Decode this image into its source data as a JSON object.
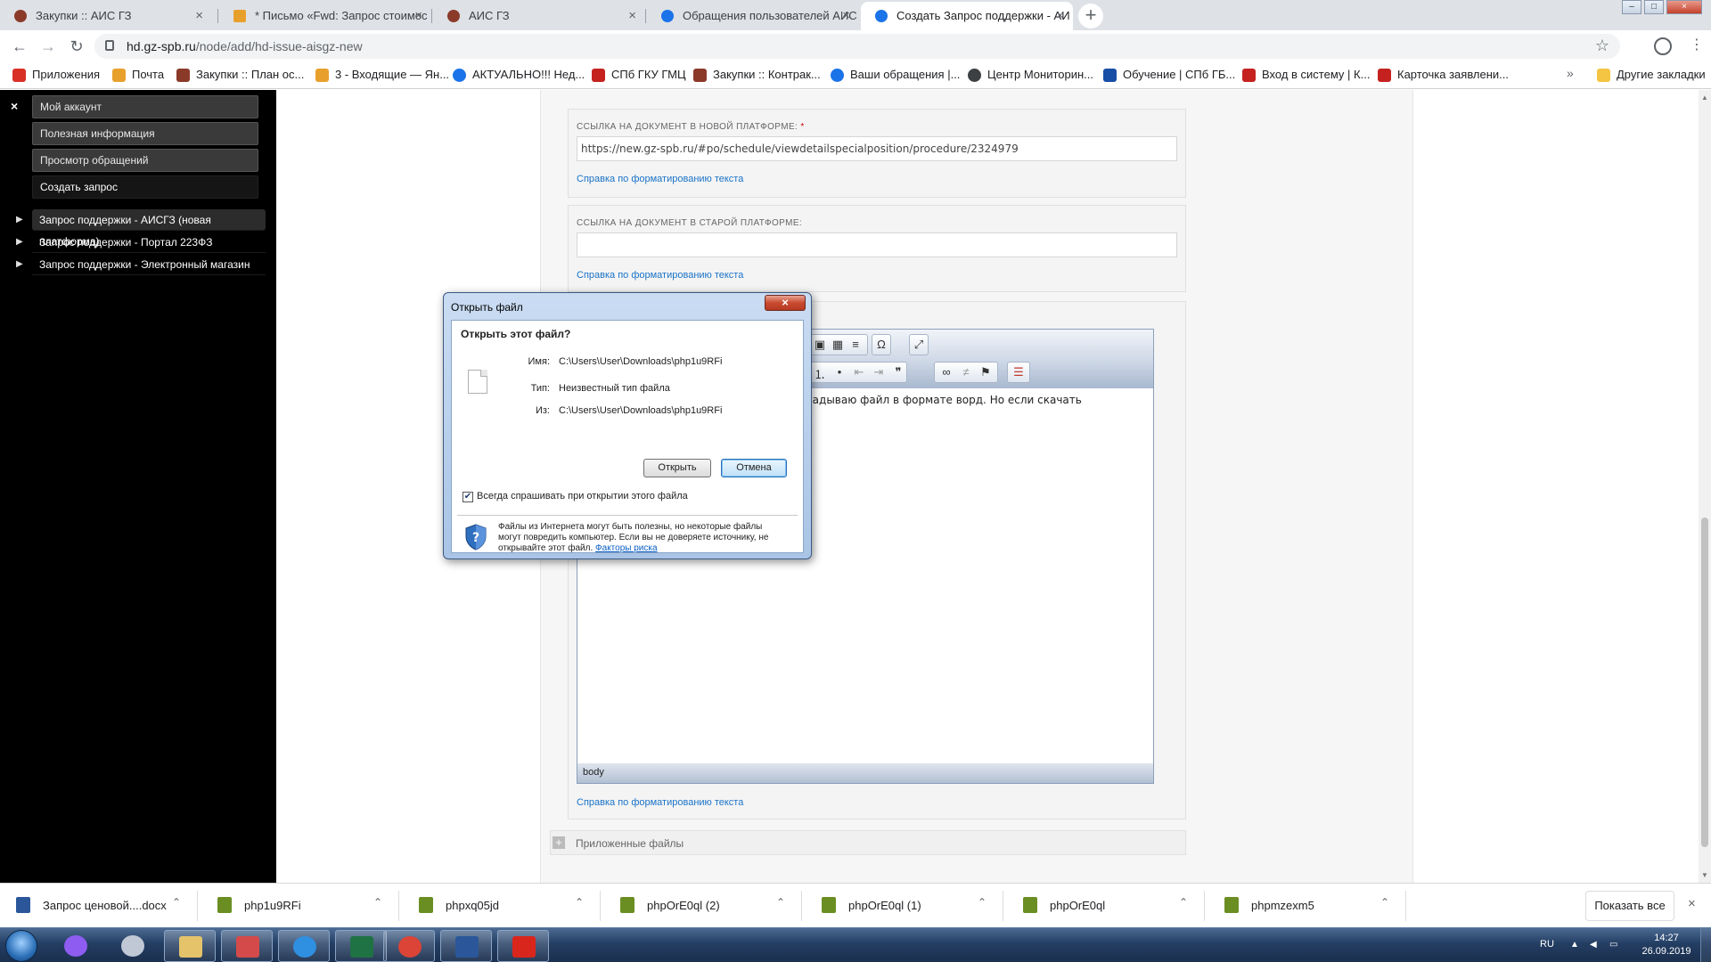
{
  "browser": {
    "tabs": [
      {
        "title": "Закупки :: АИС ГЗ",
        "icon": "tools-icon",
        "color": "#8b3a2a"
      },
      {
        "title": "* Письмо «Fwd: Запрос стоимос",
        "icon": "mail-icon",
        "color": "#e8a02c"
      },
      {
        "title": "АИС ГЗ",
        "icon": "tools-icon",
        "color": "#8b3a2a"
      },
      {
        "title": "Обращения пользователей АИС",
        "icon": "globe-icon",
        "color": "#1a73e8"
      },
      {
        "title": "Создать Запрос поддержки - АИ",
        "icon": "globe-icon",
        "color": "#1a73e8"
      }
    ],
    "new_tab_label": "+",
    "url_host": "hd.gz-spb.ru",
    "url_path": "/node/add/hd-issue-aisgz-new",
    "bookmarks": [
      {
        "label": "Приложения",
        "color": "#d93025"
      },
      {
        "label": "Почта",
        "color": "#e8a02c"
      },
      {
        "label": "Закупки :: План ос...",
        "color": "#8b3a2a"
      },
      {
        "label": "3 - Входящие — Ян...",
        "color": "#e8a02c"
      },
      {
        "label": "АКТУАЛЬНО!!! Нед...",
        "color": "#1a73e8"
      },
      {
        "label": "СПб ГКУ ГМЦ",
        "color": "#c5221f"
      },
      {
        "label": "Закупки :: Контрак...",
        "color": "#8b3a2a"
      },
      {
        "label": "Ваши обращения |...",
        "color": "#1a73e8"
      },
      {
        "label": "Центр Мониторин...",
        "color": "#3c4043"
      },
      {
        "label": "Обучение | СПб ГБ...",
        "color": "#174ea6"
      },
      {
        "label": "Вход в систему | К...",
        "color": "#c5221f"
      },
      {
        "label": "Карточка заявлени...",
        "color": "#c5221f"
      }
    ],
    "bookmarks_more": "»",
    "other_bookmarks": "Другие закладки"
  },
  "sidebar": {
    "close_label": "×",
    "menu": [
      {
        "label": "Мой аккаунт"
      },
      {
        "label": "Полезная информация"
      },
      {
        "label": "Просмотр обращений"
      },
      {
        "label": "Создать запрос"
      }
    ],
    "links": [
      {
        "label": "Запрос поддержки - АИСГЗ (новая платформа)"
      },
      {
        "label": "Запрос поддержки - Портал 223ФЗ"
      },
      {
        "label": "Запрос поддержки - Электронный магазин"
      }
    ]
  },
  "form": {
    "new_platform": {
      "label": "Ссылка на документ в новой платформе:",
      "required_mark": "*",
      "value": "https://new.gz-spb.ru/#po/schedule/viewdetailspecialposition/procedure/2324979",
      "help": "Справка по форматированию текста"
    },
    "old_platform": {
      "label": "Ссылка на документ в старой платформе:",
      "value": "",
      "help": "Справка по форматированию текста"
    },
    "body": {
      "visible_text": "ладываю файл в формате ворд. Но если скачать",
      "status_path": "body",
      "help": "Справка по форматированию текста"
    },
    "attachments_label": "Приложенные файлы"
  },
  "dialog": {
    "title": "Открыть файл",
    "close_label": "×",
    "question": "Открыть этот файл?",
    "name_label": "Имя:",
    "name_value": "C:\\Users\\User\\Downloads\\php1u9RFi",
    "type_label": "Тип:",
    "type_value": "Неизвестный тип файла",
    "from_label": "Из:",
    "from_value": "C:\\Users\\User\\Downloads\\php1u9RFi",
    "open_button": "Открыть",
    "cancel_button": "Отмена",
    "always_ask_label": "Всегда спрашивать при открытии этого файла",
    "always_ask_checked": true,
    "warning_text": "Файлы из Интернета могут быть полезны, но некоторые файлы могут повредить компьютер. Если вы не доверяете источнику, не открывайте этот файл.",
    "risk_link": "Факторы риска"
  },
  "downloads": {
    "items": [
      {
        "name": "Запрос ценовой....docx",
        "color": "#2b579a"
      },
      {
        "name": "php1u9RFi",
        "color": "#6b8e23"
      },
      {
        "name": "phpxq05jd",
        "color": "#6b8e23"
      },
      {
        "name": "phpOrE0ql (2)",
        "color": "#6b8e23"
      },
      {
        "name": "phpOrE0ql (1)",
        "color": "#6b8e23"
      },
      {
        "name": "phpOrE0ql",
        "color": "#6b8e23"
      },
      {
        "name": "phpmzexm5",
        "color": "#6b8e23"
      }
    ],
    "show_all": "Показать все",
    "close_label": "×"
  },
  "taskbar": {
    "apps": [
      {
        "name": "alice-icon",
        "color": "#8e5cf0"
      },
      {
        "name": "paint-icon",
        "color": "#c0c8d6"
      },
      {
        "name": "explorer-icon",
        "color": "#e4c36a"
      },
      {
        "name": "calendar-pdf-icon",
        "color": "#d44a4a"
      },
      {
        "name": "ie-icon",
        "color": "#2f8fe0"
      },
      {
        "name": "excel-icon",
        "color": "#1f7244"
      },
      {
        "name": "chrome-icon",
        "color": "#db4437"
      },
      {
        "name": "word-icon",
        "color": "#2b579a"
      },
      {
        "name": "acrobat-icon",
        "color": "#d9261c"
      }
    ],
    "lang": "RU",
    "time": "14:27",
    "date": "26.09.2019"
  }
}
